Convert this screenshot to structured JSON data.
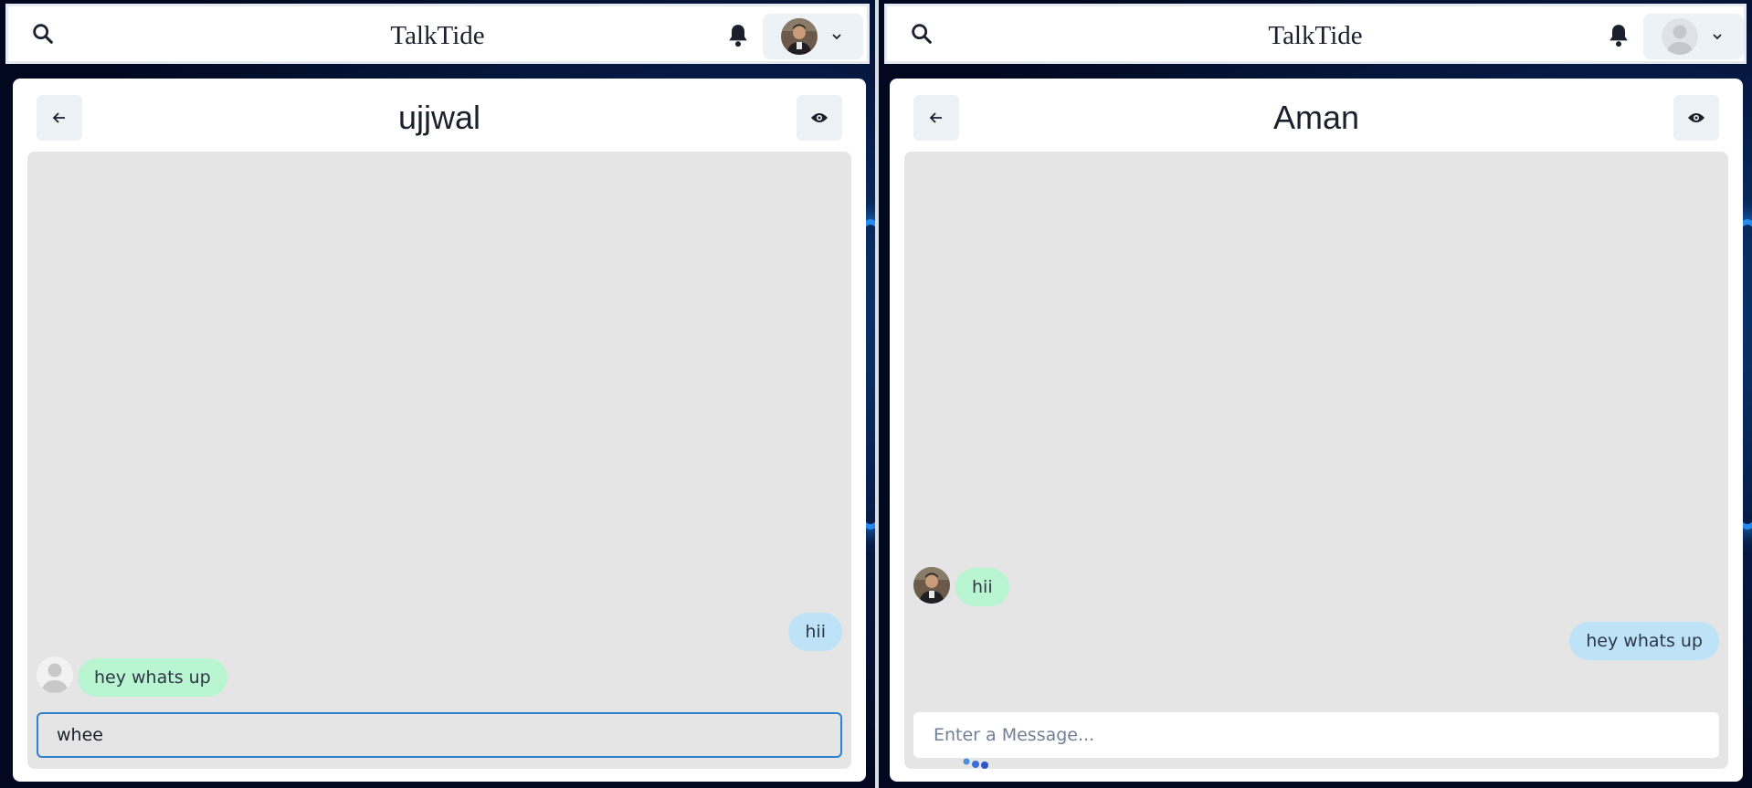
{
  "left_window": {
    "brand": "TalkTide",
    "icons": {
      "search": "search-icon",
      "bell": "bell-icon",
      "avatar": "user-photo-avatar",
      "chevron": "chevron-down-icon"
    },
    "chat": {
      "title": "ujjwal",
      "messages": [
        {
          "text": "hii",
          "sender": "me"
        },
        {
          "text": "hey whats up",
          "sender": "other"
        }
      ],
      "input": {
        "value": "whee",
        "placeholder": "Enter a Message...",
        "focused": true
      }
    }
  },
  "right_window": {
    "brand": "TalkTide",
    "icons": {
      "search": "search-icon",
      "bell": "bell-icon",
      "avatar": "default-user-avatar",
      "chevron": "chevron-down-icon"
    },
    "chat": {
      "title": "Aman",
      "messages": [
        {
          "text": "hii",
          "sender": "other"
        },
        {
          "text": "hey whats up",
          "sender": "me"
        }
      ],
      "typing_indicator": true,
      "input": {
        "value": "",
        "placeholder": "Enter a Message..."
      }
    }
  },
  "colors": {
    "my_bubble": "#bee3f8",
    "their_bubble": "#b9f5d0",
    "focus_border": "#3182ce",
    "chat_bg": "#e5e5e5"
  }
}
